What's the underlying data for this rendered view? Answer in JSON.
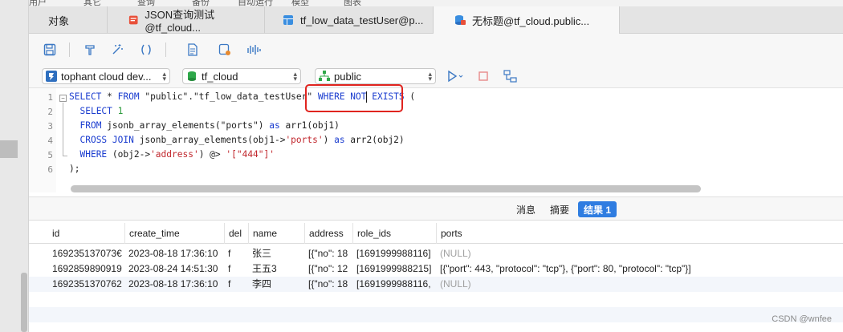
{
  "topmenu": [
    "用户",
    "其它",
    "查询",
    "备份",
    "自动运行",
    "模型",
    "图表"
  ],
  "tabs": [
    {
      "label": "对象",
      "icon": "none"
    },
    {
      "label": "JSON查询测试@tf_cloud...",
      "icon": "query-red-icon"
    },
    {
      "label": "tf_low_data_testUser@p...",
      "icon": "table-blue-icon"
    },
    {
      "label": "无标题@tf_cloud.public...",
      "icon": "query-db-icon"
    }
  ],
  "toolbar": {
    "icons": [
      "save-icon",
      "format-icon",
      "magic-wand-icon",
      "parentheses-icon",
      "document-icon",
      "code-snippet-icon",
      "explain-icon"
    ]
  },
  "selectors": {
    "connection": "tophant cloud dev...",
    "database": "tf_cloud",
    "schema": "public"
  },
  "colors": {
    "accent": "#2f7de1",
    "keyword": "#1a3ccf",
    "string": "#c1272d",
    "highlight": "#e0241f"
  },
  "editor": {
    "line_numbers": [
      "1",
      "2",
      "3",
      "4",
      "5",
      "6"
    ],
    "lines": [
      [
        {
          "t": "kw",
          "v": "SELECT"
        },
        {
          "t": "",
          "v": " * "
        },
        {
          "t": "kw",
          "v": "FROM"
        },
        {
          "t": "",
          "v": " \"public\".\"tf_low_data_testUser\" "
        },
        {
          "t": "kw",
          "v": "WHERE NOT EXISTS"
        },
        {
          "t": "",
          "v": " ("
        }
      ],
      [
        {
          "t": "",
          "v": "  "
        },
        {
          "t": "kw",
          "v": "SELECT"
        },
        {
          "t": "",
          "v": " "
        },
        {
          "t": "num",
          "v": "1"
        }
      ],
      [
        {
          "t": "",
          "v": "  "
        },
        {
          "t": "kw",
          "v": "FROM"
        },
        {
          "t": "",
          "v": " jsonb_array_elements(\"ports\") "
        },
        {
          "t": "kw",
          "v": "as"
        },
        {
          "t": "",
          "v": " arr1(obj1)"
        }
      ],
      [
        {
          "t": "",
          "v": "  "
        },
        {
          "t": "kw",
          "v": "CROSS JOIN"
        },
        {
          "t": "",
          "v": " jsonb_array_elements(obj1->"
        },
        {
          "t": "str",
          "v": "'ports'"
        },
        {
          "t": "",
          "v": ") "
        },
        {
          "t": "kw",
          "v": "as"
        },
        {
          "t": "",
          "v": " arr2(obj2)"
        }
      ],
      [
        {
          "t": "",
          "v": "  "
        },
        {
          "t": "kw",
          "v": "WHERE"
        },
        {
          "t": "",
          "v": " (obj2->"
        },
        {
          "t": "str",
          "v": "'address'"
        },
        {
          "t": "",
          "v": ") @> "
        },
        {
          "t": "str",
          "v": "'[\"444\"]'"
        }
      ],
      [
        {
          "t": "",
          "v": ");"
        }
      ]
    ]
  },
  "result_tabs": [
    "消息",
    "摘要",
    "结果 1"
  ],
  "grid": {
    "columns": [
      "id",
      "create_time",
      "del",
      "name",
      "address",
      "role_ids",
      "ports"
    ],
    "rows": [
      [
        "169235137073€",
        "2023-08-18 17:36:10",
        "f",
        "张三",
        "[{\"no\": 18",
        "[1691999988116]",
        "(NULL)"
      ],
      [
        "16928598909⁠1⁠9",
        "2023-08-24 14:51:30",
        "f",
        "王五3",
        "[{\"no\": 12",
        "[1691999988215]",
        "[{\"port\": 443, \"protocol\": \"tcp\"}, {\"port\": 80, \"protocol\": \"tcp\"}]"
      ],
      [
        "169235137076⁠2",
        "2023-08-18 17:36:10",
        "f",
        "李四",
        "[{\"no\": 18",
        "[1691999988116,",
        "(NULL)"
      ]
    ]
  },
  "watermark": "CSDN @wnfee"
}
